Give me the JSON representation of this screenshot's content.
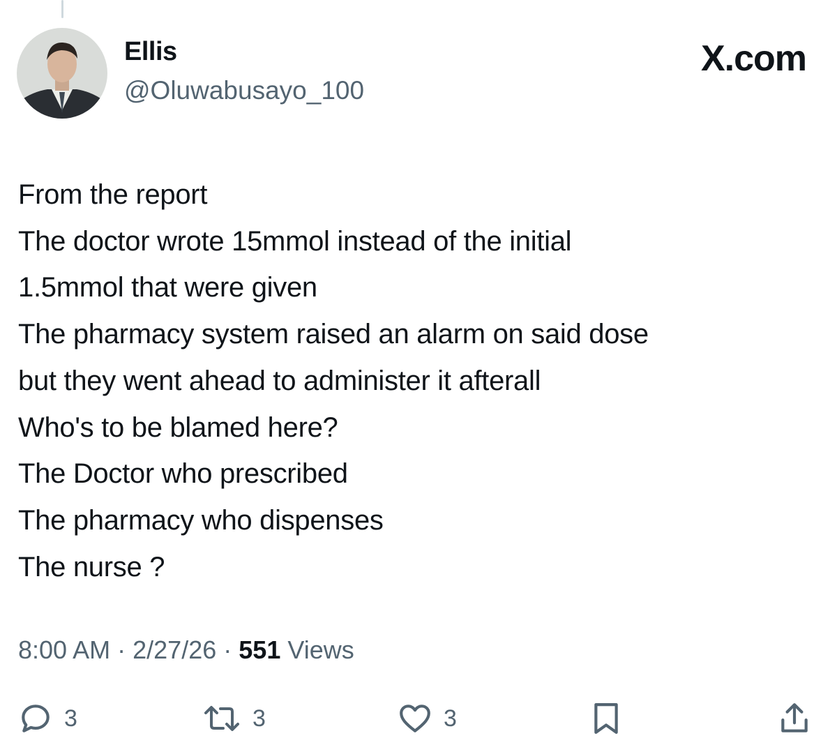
{
  "author": {
    "display_name": "Ellis",
    "handle": "@Oluwabusayo_100",
    "avatar_icon": "profile-photo-icon"
  },
  "brand": {
    "label": "X.com"
  },
  "tweet": {
    "lines": [
      "From the report",
      "The doctor wrote 15mmol instead of the initial",
      "1.5mmol that were given",
      "The pharmacy system raised an alarm on said dose",
      "but they went ahead to administer it afterall",
      "Who's to be blamed here?",
      "The Doctor who prescribed",
      "The pharmacy who dispenses",
      "The nurse ?"
    ]
  },
  "meta": {
    "time": "8:00 AM",
    "separator": "·",
    "date": "2/27/26",
    "views_count": "551",
    "views_label": "Views"
  },
  "actions": {
    "reply": {
      "icon": "reply-icon",
      "count": "3"
    },
    "repost": {
      "icon": "repost-icon",
      "count": "3"
    },
    "like": {
      "icon": "heart-icon",
      "count": "3"
    },
    "bookmark": {
      "icon": "bookmark-icon"
    },
    "share": {
      "icon": "share-icon"
    }
  },
  "colors": {
    "text_primary": "#0f1419",
    "text_secondary": "#536471",
    "background": "#ffffff"
  }
}
